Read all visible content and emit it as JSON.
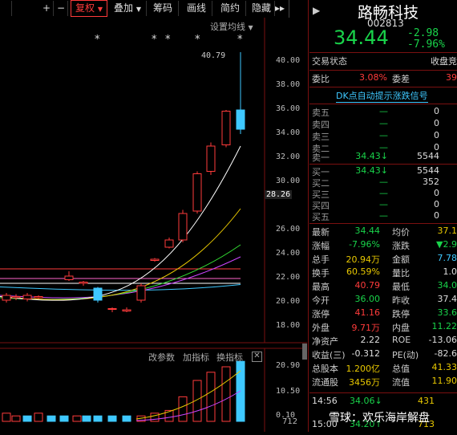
{
  "toolbar": {
    "plus": "+",
    "minus": "−",
    "fuquan": "复权",
    "diejia": "叠加",
    "choumao": "筹码",
    "huaxian": "画线",
    "jianyue": "简约",
    "yincang": "隐藏",
    "arrows": "▸▸"
  },
  "chart": {
    "setting_label": "设置均线",
    "high_label": "40.79",
    "cursor_price": "28.26",
    "y_ticks": [
      "40.00",
      "38.00",
      "36.00",
      "34.00",
      "32.00",
      "30.00",
      "26.00",
      "24.00",
      "22.00",
      "20.00",
      "18.00"
    ],
    "stars": [
      "*",
      "*",
      "*",
      "*",
      "*"
    ],
    "sub_ticks": [
      "20.90",
      "10.50"
    ],
    "sub_bottom": "0.10",
    "sub_bottom_right": "712",
    "sub_buttons": {
      "gaicanshu": "改参数",
      "jiazhibiao": "加指标",
      "huanzhibiao": "换指标",
      "close": "✕"
    }
  },
  "panel": {
    "arrow": "▶",
    "name": "路畅科技",
    "code": "002813",
    "price": "34.44",
    "change": "-2.98",
    "change_pct": "-7.96%",
    "status_label": "交易状态",
    "status_value": "收盘竞",
    "weibi_label": "委比",
    "weibi_value": "3.08%",
    "weicha_label": "委差",
    "weicha_value": "39",
    "dk_signal": "DK点自动提示涨跌信号",
    "asks": [
      {
        "label": "卖五",
        "price": "—",
        "vol": "0"
      },
      {
        "label": "卖四",
        "price": "—",
        "vol": "0"
      },
      {
        "label": "卖三",
        "price": "—",
        "vol": "0"
      },
      {
        "label": "卖二",
        "price": "—",
        "vol": "0"
      },
      {
        "label": "卖一",
        "price": "34.43↓",
        "vol": "5544"
      }
    ],
    "bids": [
      {
        "label": "买一",
        "price": "34.43↓",
        "vol": "5544"
      },
      {
        "label": "买二",
        "price": "—",
        "vol": "352"
      },
      {
        "label": "买三",
        "price": "—",
        "vol": "0"
      },
      {
        "label": "买四",
        "price": "—",
        "vol": "0"
      },
      {
        "label": "买五",
        "price": "—",
        "vol": "0"
      }
    ],
    "stats": [
      {
        "l1": "最新",
        "v1": "34.44",
        "c1": "g",
        "l2": "均价",
        "v2": "37.1",
        "c2": "y"
      },
      {
        "l1": "涨幅",
        "v1": "-7.96%",
        "c1": "g",
        "l2": "涨跌",
        "v2": "▼2.9",
        "c2": "g"
      },
      {
        "l1": "总手",
        "v1": "20.94万",
        "c1": "y",
        "l2": "金额",
        "v2": "7.78",
        "c2": "c"
      },
      {
        "l1": "换手",
        "v1": "60.59%",
        "c1": "y",
        "l2": "量比",
        "v2": "1.0",
        "c2": "w"
      },
      {
        "l1": "最高",
        "v1": "40.79",
        "c1": "r",
        "l2": "最低",
        "v2": "34.0",
        "c2": "g"
      },
      {
        "l1": "今开",
        "v1": "36.00",
        "c1": "g",
        "l2": "昨收",
        "v2": "37.4",
        "c2": "w"
      },
      {
        "l1": "涨停",
        "v1": "41.16",
        "c1": "r",
        "l2": "跌停",
        "v2": "33.6",
        "c2": "g"
      },
      {
        "l1": "外盘",
        "v1": "9.71万",
        "c1": "r",
        "l2": "内盘",
        "v2": "11.22",
        "c2": "g"
      },
      {
        "l1": "净资产",
        "v1": "2.22",
        "c1": "w",
        "l2": "ROE",
        "v2": "-13.06",
        "c2": "w"
      },
      {
        "l1": "收益(三)",
        "v1": "-0.312",
        "c1": "w",
        "l2": "PE(动)",
        "v2": "-82.6",
        "c2": "w"
      },
      {
        "l1": "总股本",
        "v1": "1.200亿",
        "c1": "y",
        "l2": "总值",
        "v2": "41.33",
        "c2": "y"
      },
      {
        "l1": "流通股",
        "v1": "3456万",
        "c1": "y",
        "l2": "流值",
        "v2": "11.90",
        "c2": "y"
      }
    ],
    "ticks": [
      {
        "time": "14:56",
        "price": "34.06↓",
        "vol": "431"
      },
      {
        "time": "15:00",
        "price": "34.20↑",
        "vol": "713"
      }
    ],
    "watermark": "雪球：欢乐海岸解盘"
  },
  "colors": {
    "up": "#ff3b3b",
    "down": "#19d34a",
    "bg": "#000000",
    "accent": "#3ec8ff"
  }
}
